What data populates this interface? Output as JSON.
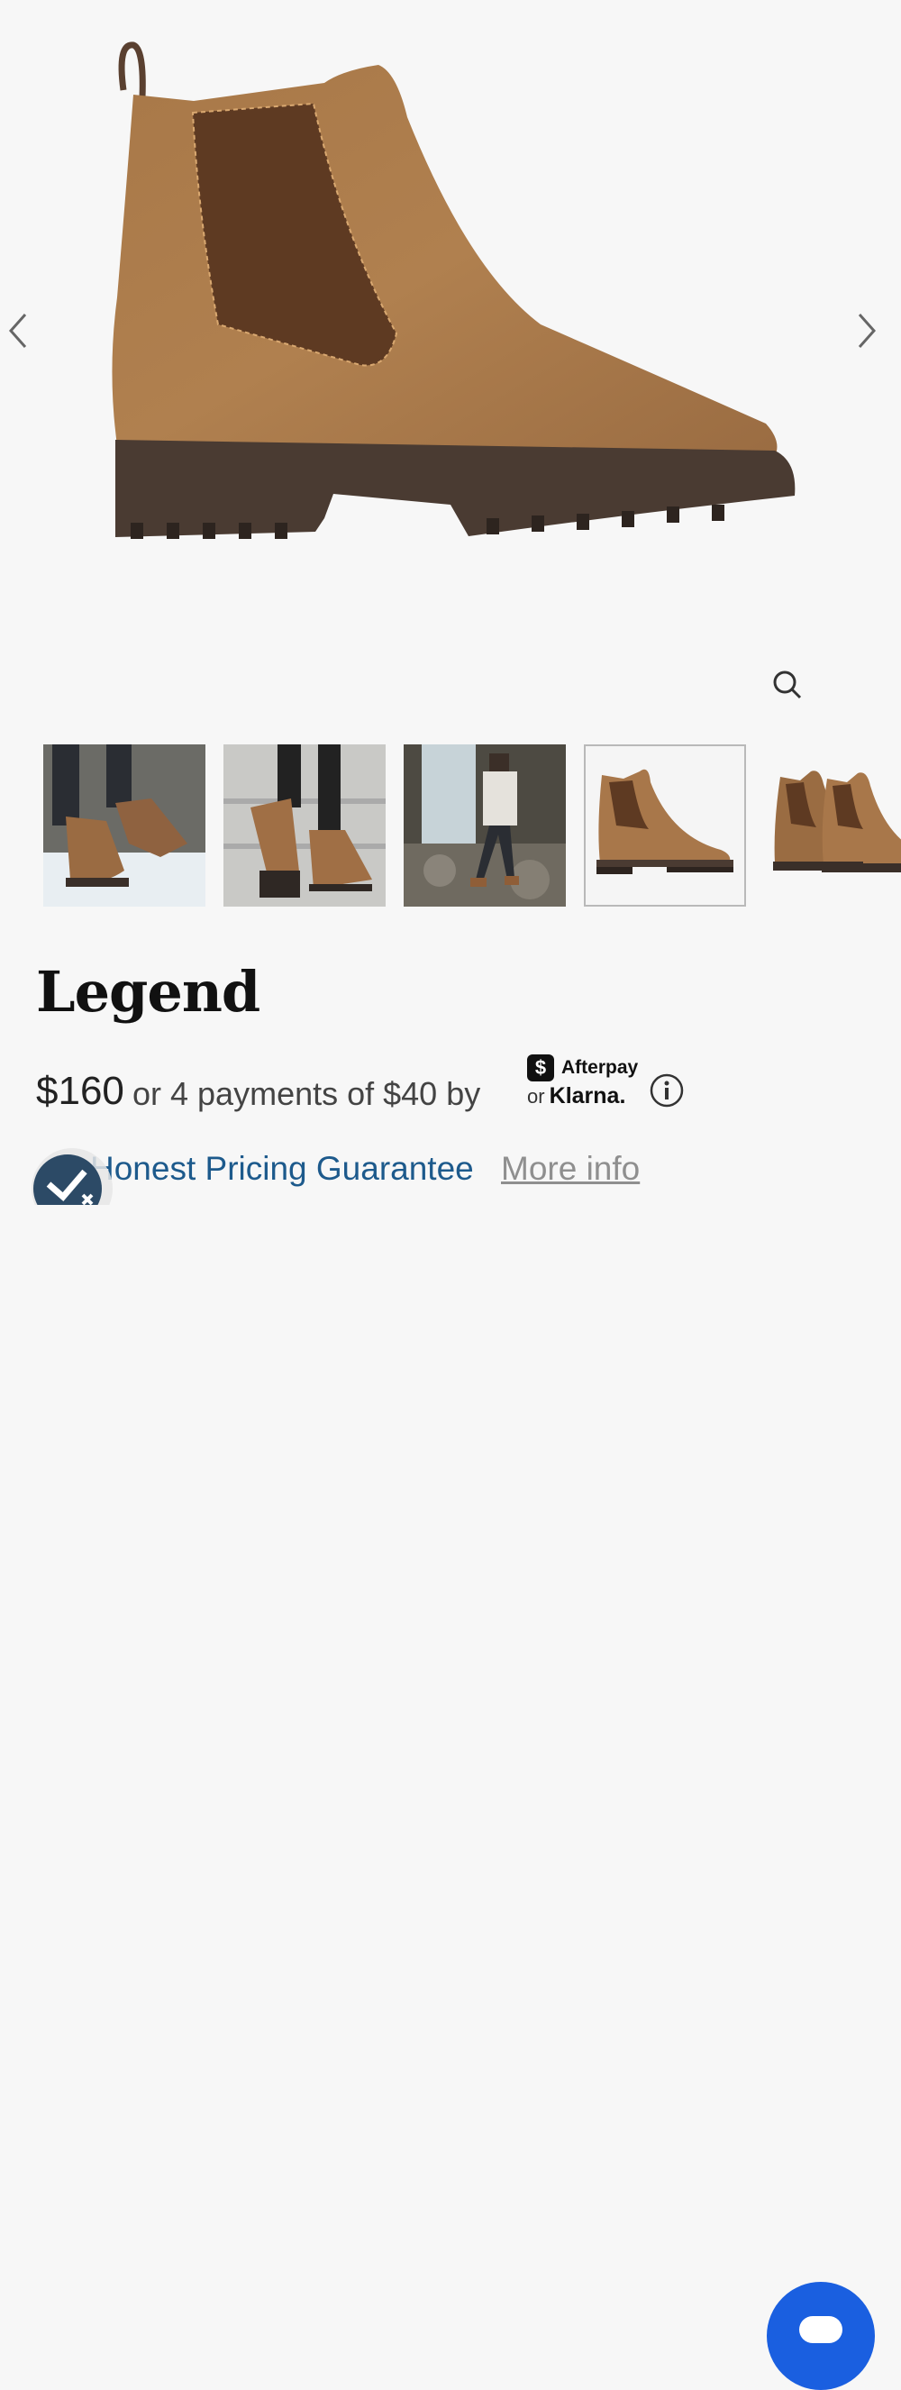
{
  "product": {
    "name": "Legend",
    "price": "$160",
    "installment_text": "or 4 payments of $40 by"
  },
  "payment_providers": {
    "afterpay_symbol": "$",
    "afterpay_label": "Afterpay",
    "or_text": "or",
    "klarna_label": "Klarna."
  },
  "guarantee": {
    "label": "Honest Pricing Guarantee",
    "more_info": "More info"
  },
  "gallery": {
    "selected_index": 3,
    "thumbnails": [
      "worn-in-snow",
      "walking-on-steps",
      "hiker-by-waterfall",
      "boot-side-view",
      "boot-pair"
    ]
  },
  "icons": {
    "prev": "chevron-left-icon",
    "next": "chevron-right-icon",
    "zoom": "zoom-icon",
    "info": "info-icon",
    "chat": "chat-icon",
    "badge": "checkmark-badge-icon"
  },
  "colors": {
    "background": "#f7f7f7",
    "guarantee_link": "#1d5a8c",
    "more_info": "#8f8f8f",
    "chat_button": "#1a5fe0",
    "boot_leather": "#a8774a",
    "boot_sole": "#4a3b32"
  }
}
